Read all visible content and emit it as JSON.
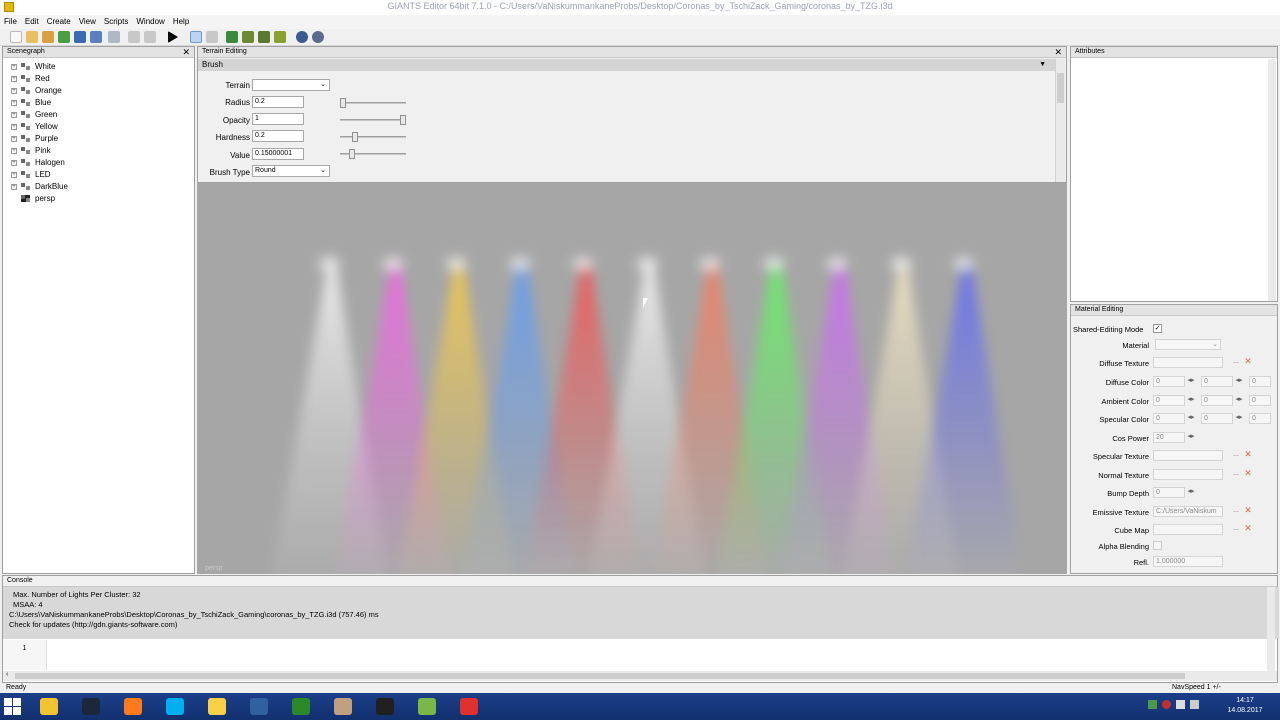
{
  "window": {
    "title": "GIANTS Editor 64bit 7.1.0 - C:/Users/VaNiskummankaneProbs/Desktop/Coronas_by_TschiZack_Gaming/coronas_by_TZG.i3d"
  },
  "menu": [
    "File",
    "Edit",
    "Create",
    "View",
    "Scripts",
    "Window",
    "Help"
  ],
  "scenegraph": {
    "title": "Scenegraph",
    "items": [
      "White",
      "Red",
      "Orange",
      "Blue",
      "Green",
      "Yellow",
      "Purple",
      "Pink",
      "Halogen",
      "LED",
      "DarkBlue",
      "persp"
    ]
  },
  "terrain": {
    "title": "Terrain Editing",
    "section": "Brush",
    "terrain_label": "Terrain",
    "terrain_value": "",
    "radius_label": "Radius",
    "radius_value": "0.2",
    "radius_level": 0.0,
    "opacity_label": "Opacity",
    "opacity_value": "1",
    "opacity_level": 1.0,
    "hardness_label": "Hardness",
    "hardness_value": "0.2",
    "hardness_level": 0.2,
    "value_label": "Value",
    "value_value": "0.15000001",
    "value_level": 0.15,
    "brushtype_label": "Brush Type",
    "brushtype_value": "Round"
  },
  "viewport": {
    "camera_label": "persp",
    "beams": [
      {
        "color": "#ffffff"
      },
      {
        "color": "#ff5cf0"
      },
      {
        "color": "#ffd040"
      },
      {
        "color": "#5a9cff"
      },
      {
        "color": "#ff4a4a"
      },
      {
        "color": "#ffffff"
      },
      {
        "color": "#ff7a5a"
      },
      {
        "color": "#5cff5a"
      },
      {
        "color": "#d064ff"
      },
      {
        "color": "#fff0c8"
      },
      {
        "color": "#5a64ff"
      }
    ]
  },
  "attributes": {
    "title": "Attributes"
  },
  "material": {
    "title": "Material Editing",
    "shared_label": "Shared-Editing Mode",
    "shared_check": "✓",
    "material_label": "Material",
    "diffuse_texture": "Diffuse Texture",
    "diffuse_color": "Diffuse Color",
    "ambient_color": "Ambient Color",
    "specular_color": "Specular Color",
    "cos_power": "Cos Power",
    "cos_power_value": "20",
    "specular_texture": "Specular Texture",
    "normal_texture": "Normal Texture",
    "bump_depth": "Bump Depth",
    "bump_value": "0",
    "emissive_texture": "Emissive Texture",
    "emissive_value": "C:/Users/VaNiskum",
    "cube_map": "Cube Map",
    "alpha_blending": "Alpha Blending",
    "refl_label": "Refl.",
    "refl_value": "1.000000",
    "zero": "0",
    "browse": "...",
    "remove": "✕"
  },
  "console": {
    "title": "Console",
    "lines": [
      "Max. Number of Lights Per Cluster: 32",
      "MSAA: 4",
      "C:\\Users\\VaNiskummankaneProbs\\Desktop\\Coronas_by_TschiZack_Gaming\\coronas_by_TZG.i3d (757.46) ms",
      "Check for updates (http://gdn.giants-software.com)"
    ],
    "line_number": "1"
  },
  "status": {
    "left": "Ready",
    "right": "NavSpeed 1 +/-"
  },
  "taskbar": {
    "time": "14:17",
    "date": "14.08.2017",
    "apps": [
      {
        "icon": "folder-icon",
        "color": "#f4c430"
      },
      {
        "icon": "steam-icon",
        "color": "#1b2838"
      },
      {
        "icon": "firefox-icon",
        "color": "#ff7a1a"
      },
      {
        "icon": "skype-icon",
        "color": "#00aff0"
      },
      {
        "icon": "files-icon",
        "color": "#f8d048"
      },
      {
        "icon": "giants-icon",
        "color": "#3060a0"
      },
      {
        "icon": "gimp-icon",
        "color": "#2a8a2a"
      },
      {
        "icon": "notes-icon",
        "color": "#c0a080"
      },
      {
        "icon": "obs-icon",
        "color": "#202020"
      },
      {
        "icon": "editor-icon",
        "color": "#7ab648"
      },
      {
        "icon": "game-icon",
        "color": "#e03030"
      }
    ]
  }
}
